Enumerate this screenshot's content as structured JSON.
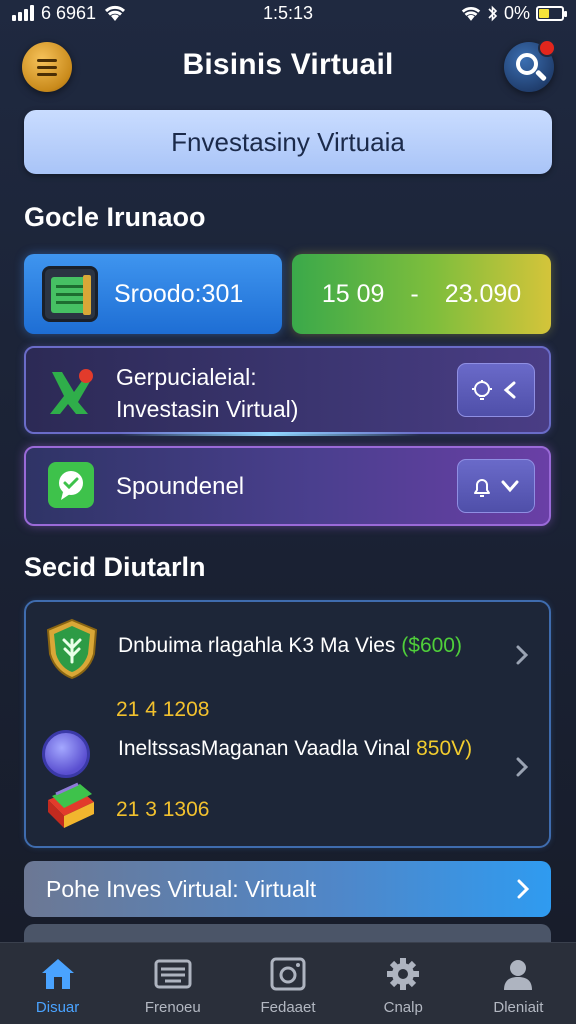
{
  "status_bar": {
    "carrier": "6 6961",
    "time": "1:5:13",
    "battery_pct": "0%"
  },
  "header": {
    "title": "Bisinis Virtuail",
    "menu_icon": "hamburger-icon",
    "search_icon": "search-icon"
  },
  "banner": {
    "text": "Fnvestasiny Virtuaia"
  },
  "section_overview": {
    "title": "Gocle Irunaoo"
  },
  "stat_cards": {
    "left": {
      "text": "Sroodo:301",
      "icon": "ledger-icon"
    },
    "right": {
      "value_a": "15 09",
      "separator": "-",
      "value_b": "23.090"
    }
  },
  "feature_cards": [
    {
      "line1": "Gerpucialeial:",
      "line2": "Investasin Virtual)",
      "icon": "chart-arrow-icon",
      "control_icons": [
        "bulb-icon",
        "chevron-left-icon"
      ]
    },
    {
      "line1": "Spoundenel",
      "icon": "chat-bubble-icon",
      "control_icons": [
        "bell-icon",
        "chevron-down-icon"
      ]
    }
  ],
  "section_list": {
    "title": "Secid Diutarln"
  },
  "list_items": [
    {
      "text": "Dnbuima rlagahla K3 Ma Vies",
      "amount": "($600)",
      "date": "21 4 1208",
      "icon": "shield-leaf-icon"
    },
    {
      "text": "IneltssasMaganan Vaadla Vinal",
      "amount": "850V)",
      "date": "21 3 1306",
      "icon": "books-gem-icon"
    }
  ],
  "promo": {
    "text": "Pohe Inves Virtual: Virtualt"
  },
  "bottom_nav": [
    {
      "label": "Disuar",
      "icon": "home-icon",
      "active": true
    },
    {
      "label": "Frenoeu",
      "icon": "keyboard-icon",
      "active": false
    },
    {
      "label": "Fedaaet",
      "icon": "camera-icon",
      "active": false
    },
    {
      "label": "Cnalp",
      "icon": "gear-icon",
      "active": false
    },
    {
      "label": "Dleniait",
      "icon": "user-icon",
      "active": false
    }
  ],
  "colors": {
    "background": "#1f2940",
    "accent_blue": "#2f9bf0",
    "amount_green": "#4fcf3a",
    "amount_yellow": "#f2cc2e",
    "nav_active": "#4aa3ff"
  }
}
